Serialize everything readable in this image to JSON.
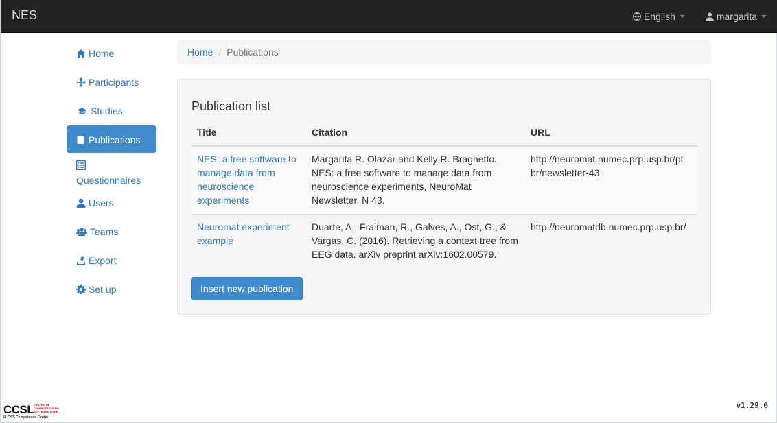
{
  "navbar": {
    "brand": "NES",
    "language": "English",
    "user": "margarita"
  },
  "sidebar": {
    "items": [
      {
        "label": "Home",
        "icon": "home-icon"
      },
      {
        "label": "Participants",
        "icon": "move-icon"
      },
      {
        "label": "Studies",
        "icon": "graduation-cap-icon"
      },
      {
        "label": "Publications",
        "icon": "book-icon",
        "active": true
      },
      {
        "label": "Questionnaires",
        "icon": "list-alt-icon"
      },
      {
        "label": "Users",
        "icon": "user-icon"
      },
      {
        "label": "Teams",
        "icon": "group-icon"
      },
      {
        "label": "Export",
        "icon": "export-icon"
      },
      {
        "label": "Set up",
        "icon": "cog-icon"
      }
    ]
  },
  "breadcrumb": {
    "home": "Home",
    "current": "Publications"
  },
  "publications": {
    "heading": "Publication list",
    "columns": [
      "Title",
      "Citation",
      "URL"
    ],
    "rows": [
      {
        "title": "NES: a free software to manage data from neuroscience experiments",
        "citation": "Margarita R. Olazar and Kelly R. Braghetto. NES: a free software to manage data from neuroscience experiments, NeuroMat Newsletter, N 43.",
        "url": "http://neuromat.numec.prp.usp.br/pt-br/newsletter-43"
      },
      {
        "title": "Neuromat experiment example",
        "citation": "Duarte, A., Fraiman, R., Galves, A., Ost, G., & Vargas, C. (2016). Retrieving a context tree from EEG data. arXiv preprint arXiv:1602.00579.",
        "url": "http://neuromatdb.numec.prp.usp.br/"
      }
    ],
    "insert_button": "Insert new publication"
  },
  "footer": {
    "logo_text": "CCSL",
    "logo_subtitle": "CENTRO DE COMPETÊNCIA EM SOFTWARE LIVRE",
    "logo_tagline": "FLOSS Competence Center",
    "version": "v1.29.0"
  },
  "colors": {
    "navbar": "#222222",
    "accent": "#428bca",
    "link": "#337ab7"
  }
}
